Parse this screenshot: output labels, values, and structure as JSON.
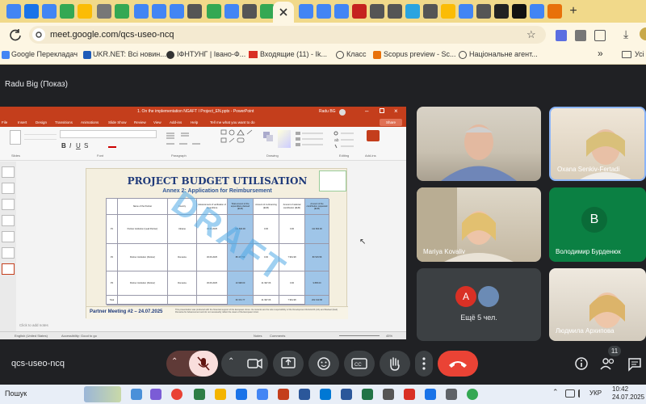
{
  "browser": {
    "url": "meet.google.com/qcs-useo-ncq",
    "bookmarks": [
      "Google Перекладач",
      "UKR.NET: Всі новин...",
      "ІФНТУНГ | Івано-Ф...",
      "Входящие (11) - Ik...",
      "Класс",
      "Scopus preview - Sc...",
      "Національне агент..."
    ],
    "bookmarks_more": "»",
    "other_bookmarks": "Усі"
  },
  "meet": {
    "presenter_title": "Radu Big (Показ)",
    "meeting_code": "qcs-useo-ncq",
    "participant_count": "11",
    "more_people_label": "Ещё 5 чел.",
    "more_people_avatar": "A",
    "participants": [
      {
        "name": "",
        "kind": "video"
      },
      {
        "name": "Oxana Senkiv-Fertadi",
        "kind": "video"
      },
      {
        "name": "Mariya Kovaliv",
        "kind": "video"
      },
      {
        "name": "Володимир Бурденюк",
        "kind": "avatar",
        "initial": "В"
      },
      {
        "name": "Людмила Архипова",
        "kind": "video"
      }
    ]
  },
  "ppt": {
    "title_bar": "1. On the implementation NGAFT I Project_EN.pptx  -  PowerPoint",
    "user": "Radu BG",
    "tabs": [
      "File",
      "Insert",
      "Design",
      "Transitions",
      "Animations",
      "Slide Show",
      "Review",
      "View",
      "Add-ins",
      "Help",
      "Tell me what you want to do"
    ],
    "share_label": "Share",
    "groups": [
      "Slides",
      "Font",
      "Paragraph",
      "Drawing",
      "Editing",
      "Add-ins"
    ],
    "slide_title": "PROJECT BUDGET UTILISATION",
    "slide_subtitle": "Annex 2: Application for Reimbursement",
    "watermark": "DRAFT",
    "table_headers": [
      "",
      "Name of the Partner",
      "Country",
      "Advancement of verification of expenditure",
      "Total amount of the expenditure claimed (EUR)",
      "Amount of co-financing (EUR)",
      "Amount of national contribution (EUR)",
      "Amount of the contribution requested (EUR)"
    ],
    "table_rows": [
      [
        "P1",
        "Partner institution (Lead Partner)",
        "Ukraine",
        "30.06.2025",
        "111 600.00",
        "0.00",
        "0.00",
        "111 600.00"
      ],
      [
        "P2",
        "Partner institution (Partner)",
        "Romania",
        "30.06.2025",
        "88 477.56",
        "0.00",
        "7 961.98",
        "80 515.58"
      ],
      [
        "P3",
        "Partner institution (Partner)",
        "Romania",
        "30.06.2025",
        "10 998.00",
        "21 997.06",
        "0.00",
        "9 895.00"
      ]
    ],
    "table_total": [
      "Total",
      "",
      "",
      "",
      "60 372.77",
      "21 997.06",
      "7 961.98",
      "202 010.58"
    ],
    "footer_left": "Partner Meeting #2 – 24.07.2025",
    "footer_note": "This presentation was produced with the financial support of the European Union. Its contents are the sole responsibility of the Development RAGGIUS (UA) and Mariaet (Ikari) Romania for Advancement and do not necessarily reflect the views of the European Union",
    "notes_label": "Click to add notes",
    "status_left": "English (United States)",
    "status_access": "Accessibility: Good to go",
    "status_notes": "Notes",
    "status_comments": "Comments",
    "zoom": "45%"
  },
  "taskbar": {
    "search_label": "Пошук",
    "time": "10:42",
    "date": "24.07.2025",
    "lang": "УКР"
  },
  "colors": {
    "meet_bg": "#202124",
    "ppt_accent": "#c43e1c",
    "end_call": "#ea4335",
    "mic_off": "#f9dedc",
    "avatar_green": "#0b8043",
    "avatar_red": "#d93025"
  }
}
